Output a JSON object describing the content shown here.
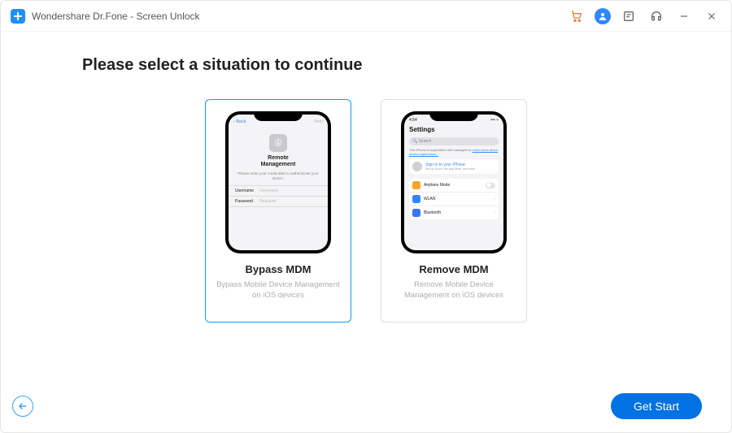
{
  "window": {
    "title": "Wondershare Dr.Fone - Screen Unlock"
  },
  "heading": "Please select a situation to continue",
  "options": {
    "bypass": {
      "title": "Bypass MDM",
      "desc": "Bypass Mobile Device Management on iOS devices",
      "phone": {
        "back": "Back",
        "next": "Next",
        "heading_line1": "Remote",
        "heading_line2": "Management",
        "subtext": "Please enter your credentials to authenticate your device.",
        "username_label": "Username",
        "username_placeholder": "Username",
        "password_label": "Password",
        "password_placeholder": "Required"
      }
    },
    "remove": {
      "title": "Remove MDM",
      "desc": "Remove Mobile Device Management on iOS devices",
      "phone": {
        "time": "4:54",
        "heading": "Settings",
        "search_placeholder": "Search",
        "info_line1": "This iPhone is supervised and managed by",
        "info_link": "Learn more about device supervision...",
        "signin_title": "Sign in to your iPhone",
        "signin_sub": "Set up iCloud, the App Store, and more.",
        "items": [
          {
            "label": "Airplane Mode"
          },
          {
            "label": "WLAN"
          },
          {
            "label": "Bluetooth"
          }
        ]
      }
    }
  },
  "footer": {
    "start": "Get Start"
  }
}
